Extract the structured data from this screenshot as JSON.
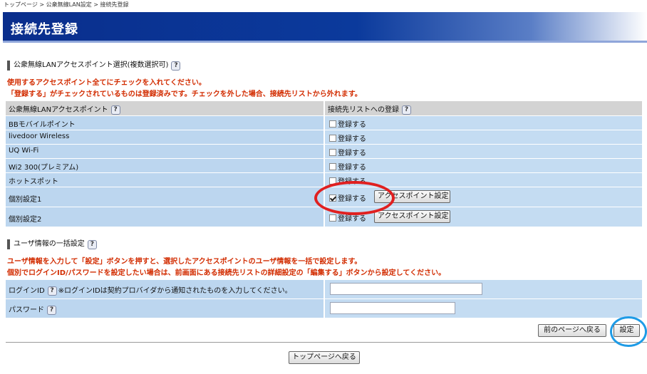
{
  "breadcrumb": "トップページ > 公衆無線LAN設定 > 接続先登録",
  "page_title": "接続先登録",
  "ap_section": {
    "heading": "公衆無線LANアクセスポイント選択(複数選択可)",
    "note1": "使用するアクセスポイント全てにチェックを入れてください。",
    "note2": "「登録する」がチェックされているものは登録済みです。チェックを外した場合、接続先リストから外れます。",
    "col_ap": "公衆無線LANアクセスポイント",
    "col_register": "接続先リストへの登録",
    "register_label": "登録する",
    "ap_settings_label": "アクセスポイント設定",
    "rows": [
      {
        "name": "BBモバイルポイント",
        "checked": false
      },
      {
        "name": "livedoor Wireless",
        "checked": false
      },
      {
        "name": "UQ Wi-Fi",
        "checked": false
      },
      {
        "name": "Wi2 300(プレミアム)",
        "checked": false
      },
      {
        "name": "ホットスポット",
        "checked": false
      },
      {
        "name": "個別設定1",
        "checked": true
      },
      {
        "name": "個別設定2",
        "checked": false
      }
    ]
  },
  "user_section": {
    "heading": "ユーザ情報の一括設定",
    "note1": "ユーザ情報を入力して「設定」ボタンを押すと、選択したアクセスポイントのユーザ情報を一括で設定します。",
    "note2": "個別でログインID/パスワードを設定したい場合は、前画面にある接続先リストの詳細設定の「編集する」ボタンから設定してください。",
    "login_label": "ログインID",
    "login_note": "※ログインIDは契約プロバイダから通知されたものを入力してください。",
    "login_value": "",
    "password_label": "パスワード",
    "password_value": ""
  },
  "buttons": {
    "back": "前のページへ戻る",
    "submit": "設定",
    "top": "トップページへ戻る"
  },
  "help_glyph": "?",
  "colors": {
    "title_bar": "#0a2e8c",
    "note_red": "#d22c00",
    "row_bg": "#bcd6ef",
    "circle_red": "#e02020",
    "circle_blue": "#1e9be6"
  }
}
